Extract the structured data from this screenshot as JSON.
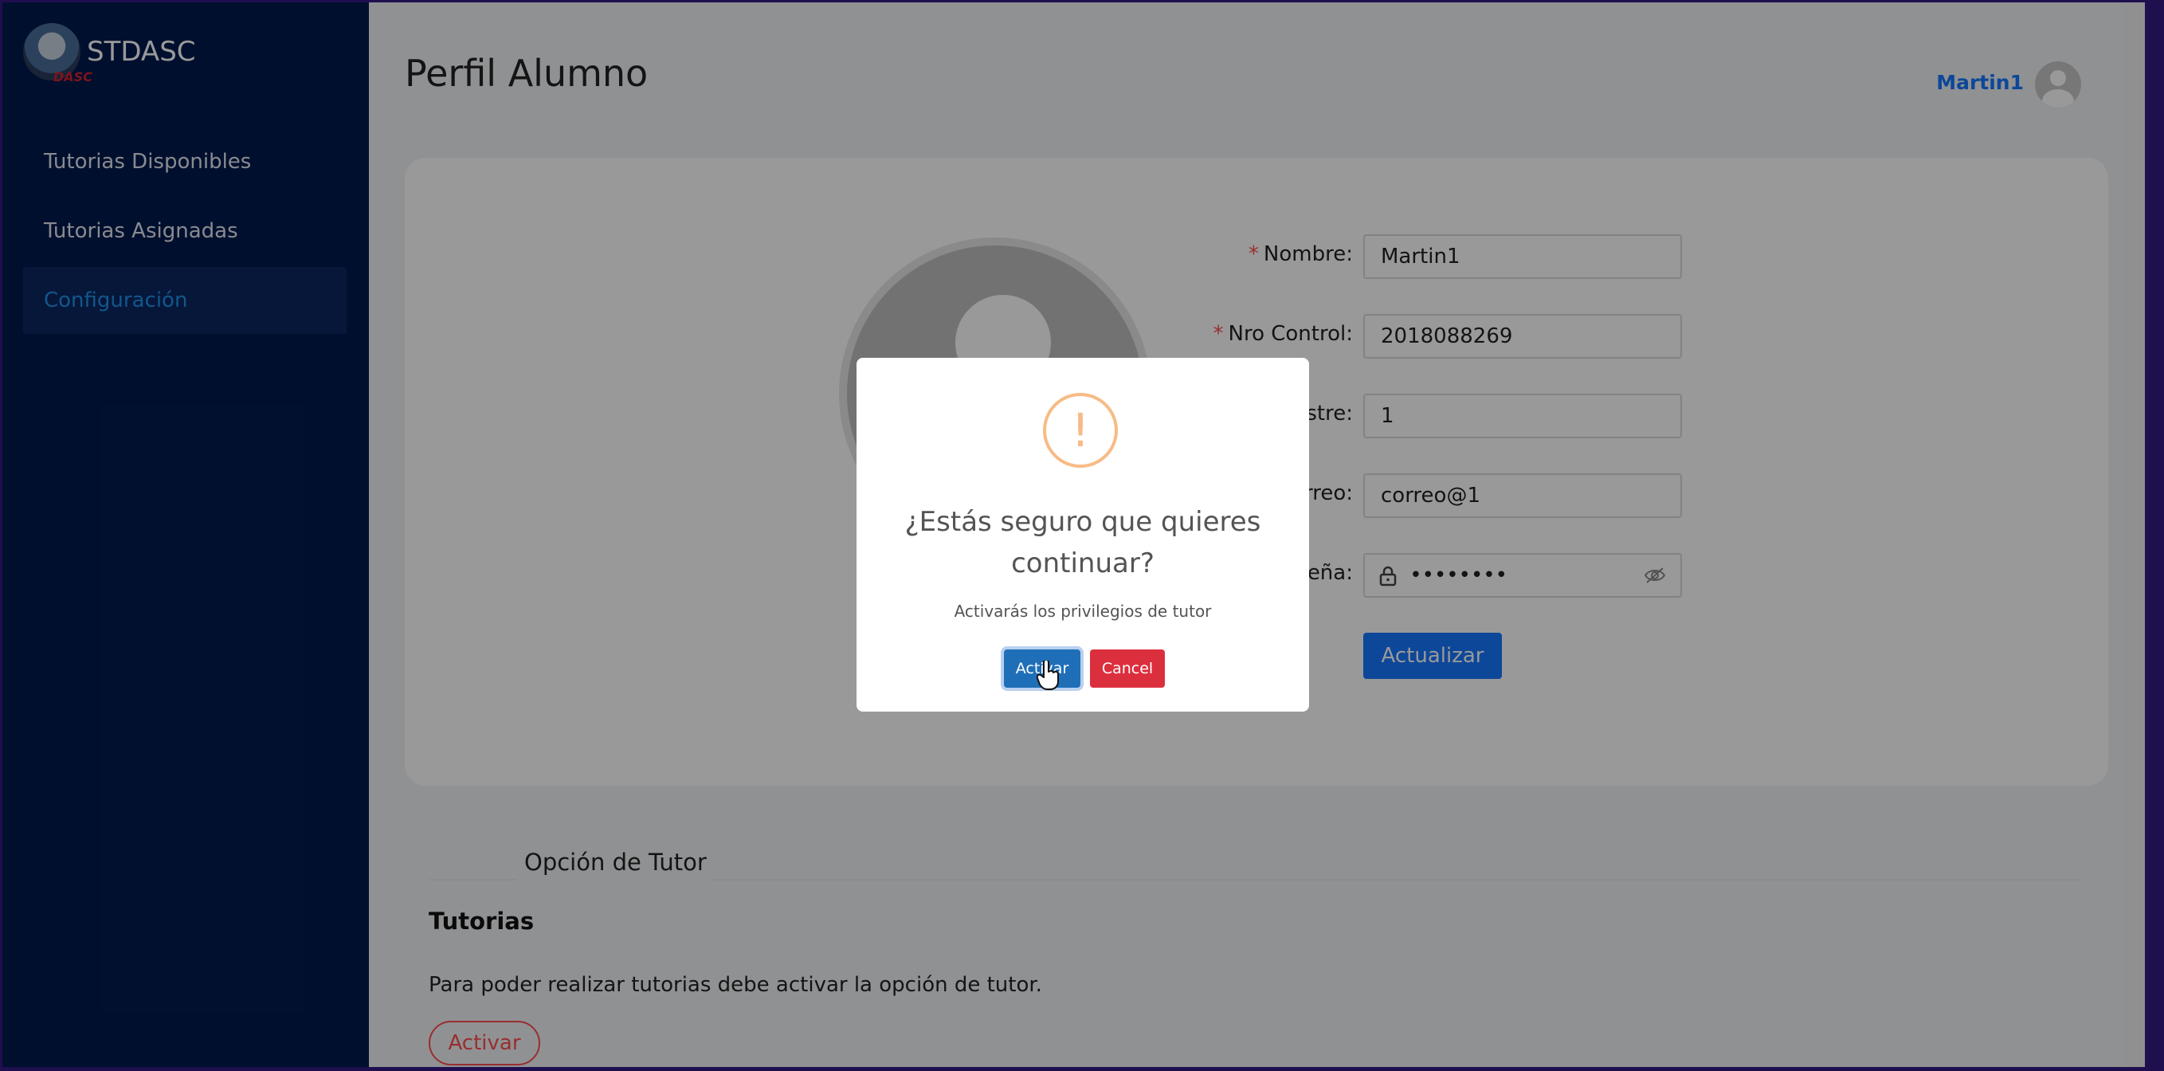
{
  "sidebar": {
    "brand": "STDASC",
    "logo_badge": "DASC",
    "items": [
      {
        "label": "Tutorias Disponibles",
        "active": false
      },
      {
        "label": "Tutorias Asignadas",
        "active": false
      },
      {
        "label": "Configuración",
        "active": true
      }
    ]
  },
  "header": {
    "title": "Perfil Alumno",
    "user_name": "Martin1"
  },
  "profile_form": {
    "fields": [
      {
        "label": "Nombre",
        "required": true,
        "value": "Martin1"
      },
      {
        "label": "Nro Control",
        "required": true,
        "value": "2018088269"
      },
      {
        "label_visible": "stre",
        "value": "1"
      },
      {
        "label_visible": "rreo",
        "value": "correo@1"
      },
      {
        "label_visible": "eña",
        "value": "••••••••"
      }
    ],
    "update_button": "Actualizar"
  },
  "tutor_section": {
    "tab_label": "Opción de Tutor",
    "title": "Tutorias",
    "description": "Para poder realizar tutorias debe activar la opción de tutor.",
    "activate_button": "Activar"
  },
  "modal": {
    "icon": "!",
    "title_line1": "¿Estás seguro que quieres",
    "title_line2": "continuar?",
    "text": "Activarás los privilegios de tutor",
    "confirm_button": "Activar",
    "cancel_button": "Cancel"
  },
  "colors": {
    "sidebar_bg": "#001a4d",
    "accent": "#1677ff",
    "danger": "#dc2f3e",
    "warning": "#f8bb86"
  }
}
